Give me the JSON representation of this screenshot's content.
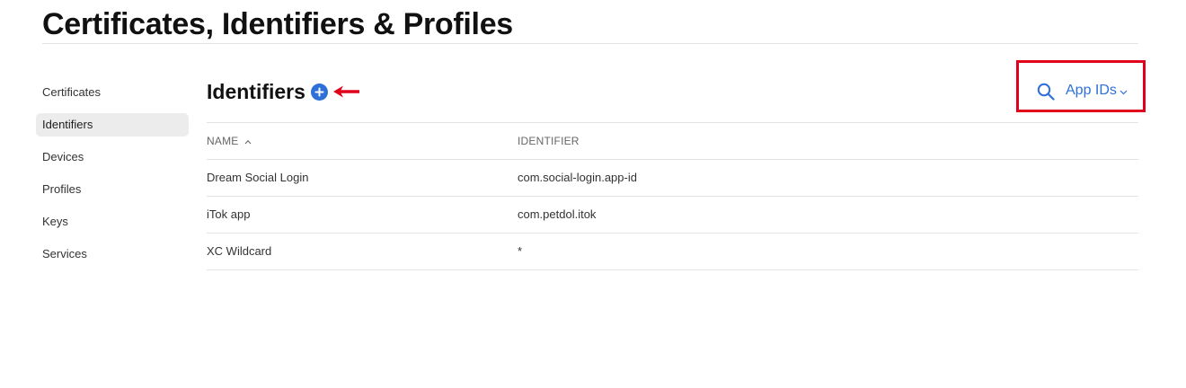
{
  "page": {
    "title": "Certificates, Identifiers & Profiles"
  },
  "sidebar": {
    "items": [
      {
        "label": "Certificates",
        "active": false
      },
      {
        "label": "Identifiers",
        "active": true
      },
      {
        "label": "Devices",
        "active": false
      },
      {
        "label": "Profiles",
        "active": false
      },
      {
        "label": "Keys",
        "active": false
      },
      {
        "label": "Services",
        "active": false
      }
    ]
  },
  "section": {
    "title": "Identifiers",
    "add_icon": "plus-circle-icon",
    "annotation_icon": "red-arrow-left-icon"
  },
  "filter": {
    "search_icon": "search-icon",
    "selected_type": "App IDs",
    "dropdown_icon": "chevron-down-icon"
  },
  "table": {
    "columns": [
      "NAME",
      "IDENTIFIER"
    ],
    "sort_icon": "sort-ascending-caret-icon",
    "rows": [
      {
        "name": "Dream Social Login",
        "identifier": "com.social-login.app-id"
      },
      {
        "name": "iTok app",
        "identifier": "com.petdol.itok"
      },
      {
        "name": "XC Wildcard",
        "identifier": "*"
      }
    ]
  },
  "colors": {
    "accent": "#2f6fd8",
    "annotation": "#e0001b",
    "divider": "#e2e2e2",
    "active_bg": "#ececec"
  }
}
